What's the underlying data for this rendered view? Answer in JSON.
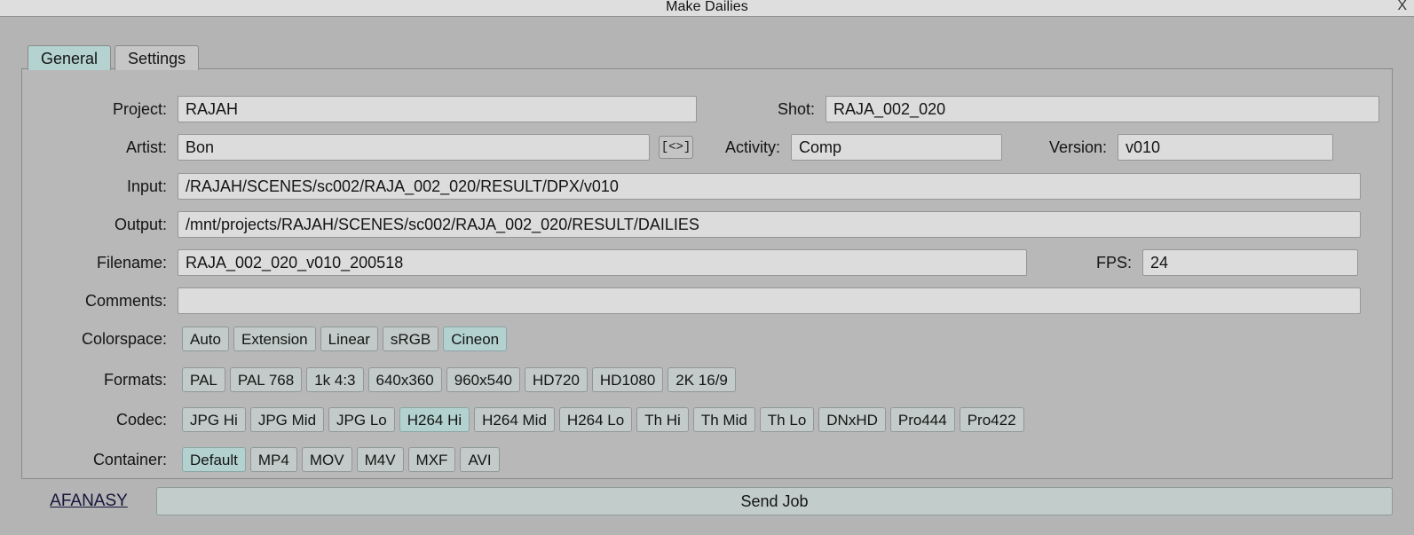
{
  "window": {
    "title": "Make Dailies",
    "close_label": "X"
  },
  "tabs": [
    {
      "label": "General",
      "selected": true
    },
    {
      "label": "Settings",
      "selected": false
    }
  ],
  "form": {
    "project": {
      "label": "Project:",
      "value": "RAJAH"
    },
    "shot": {
      "label": "Shot:",
      "value": "RAJA_002_020"
    },
    "artist": {
      "label": "Artist:",
      "value": "Bon"
    },
    "artist_swap": {
      "label": "[<>]"
    },
    "activity": {
      "label": "Activity:",
      "value": "Comp"
    },
    "version": {
      "label": "Version:",
      "value": "v010"
    },
    "input": {
      "label": "Input:",
      "value": "/RAJAH/SCENES/sc002/RAJA_002_020/RESULT/DPX/v010"
    },
    "output": {
      "label": "Output:",
      "value": "/mnt/projects/RAJAH/SCENES/sc002/RAJA_002_020/RESULT/DAILIES"
    },
    "filename": {
      "label": "Filename:",
      "value": "RAJA_002_020_v010_200518"
    },
    "fps": {
      "label": "FPS:",
      "value": "24"
    },
    "comments": {
      "label": "Comments:",
      "value": ""
    }
  },
  "colorspace": {
    "label": "Colorspace:",
    "options": [
      {
        "label": "Auto",
        "selected": false
      },
      {
        "label": "Extension",
        "selected": false
      },
      {
        "label": "Linear",
        "selected": false
      },
      {
        "label": "sRGB",
        "selected": false
      },
      {
        "label": "Cineon",
        "selected": true
      }
    ]
  },
  "formats": {
    "label": "Formats:",
    "options": [
      {
        "label": "PAL",
        "selected": false
      },
      {
        "label": "PAL 768",
        "selected": false
      },
      {
        "label": "1k 4:3",
        "selected": false
      },
      {
        "label": "640x360",
        "selected": false
      },
      {
        "label": "960x540",
        "selected": false
      },
      {
        "label": "HD720",
        "selected": false
      },
      {
        "label": "HD1080",
        "selected": false
      },
      {
        "label": "2K 16/9",
        "selected": false
      }
    ]
  },
  "codec": {
    "label": "Codec:",
    "options": [
      {
        "label": "JPG Hi",
        "selected": false
      },
      {
        "label": "JPG Mid",
        "selected": false
      },
      {
        "label": "JPG Lo",
        "selected": false
      },
      {
        "label": "H264 Hi",
        "selected": true
      },
      {
        "label": "H264 Mid",
        "selected": false
      },
      {
        "label": "H264 Lo",
        "selected": false
      },
      {
        "label": "Th Hi",
        "selected": false
      },
      {
        "label": "Th Mid",
        "selected": false
      },
      {
        "label": "Th Lo",
        "selected": false
      },
      {
        "label": "DNxHD",
        "selected": false
      },
      {
        "label": "Pro444",
        "selected": false
      },
      {
        "label": "Pro422",
        "selected": false
      }
    ]
  },
  "container": {
    "label": "Container:",
    "options": [
      {
        "label": "Default",
        "selected": true
      },
      {
        "label": "MP4",
        "selected": false
      },
      {
        "label": "MOV",
        "selected": false
      },
      {
        "label": "M4V",
        "selected": false
      },
      {
        "label": "MXF",
        "selected": false
      },
      {
        "label": "AVI",
        "selected": false
      }
    ]
  },
  "footer": {
    "afanasy_label": "AFANASY",
    "send_job_label": "Send Job"
  },
  "colors": {
    "window_bg": "#b4b4b4",
    "panel_bg": "#b8b8b8",
    "titlebar_bg": "#dedede",
    "field_bg": "#dcdcdc",
    "button_bg": "#c2cbc9",
    "selected_teal": "#b3d2cf",
    "link": "#14143c"
  }
}
